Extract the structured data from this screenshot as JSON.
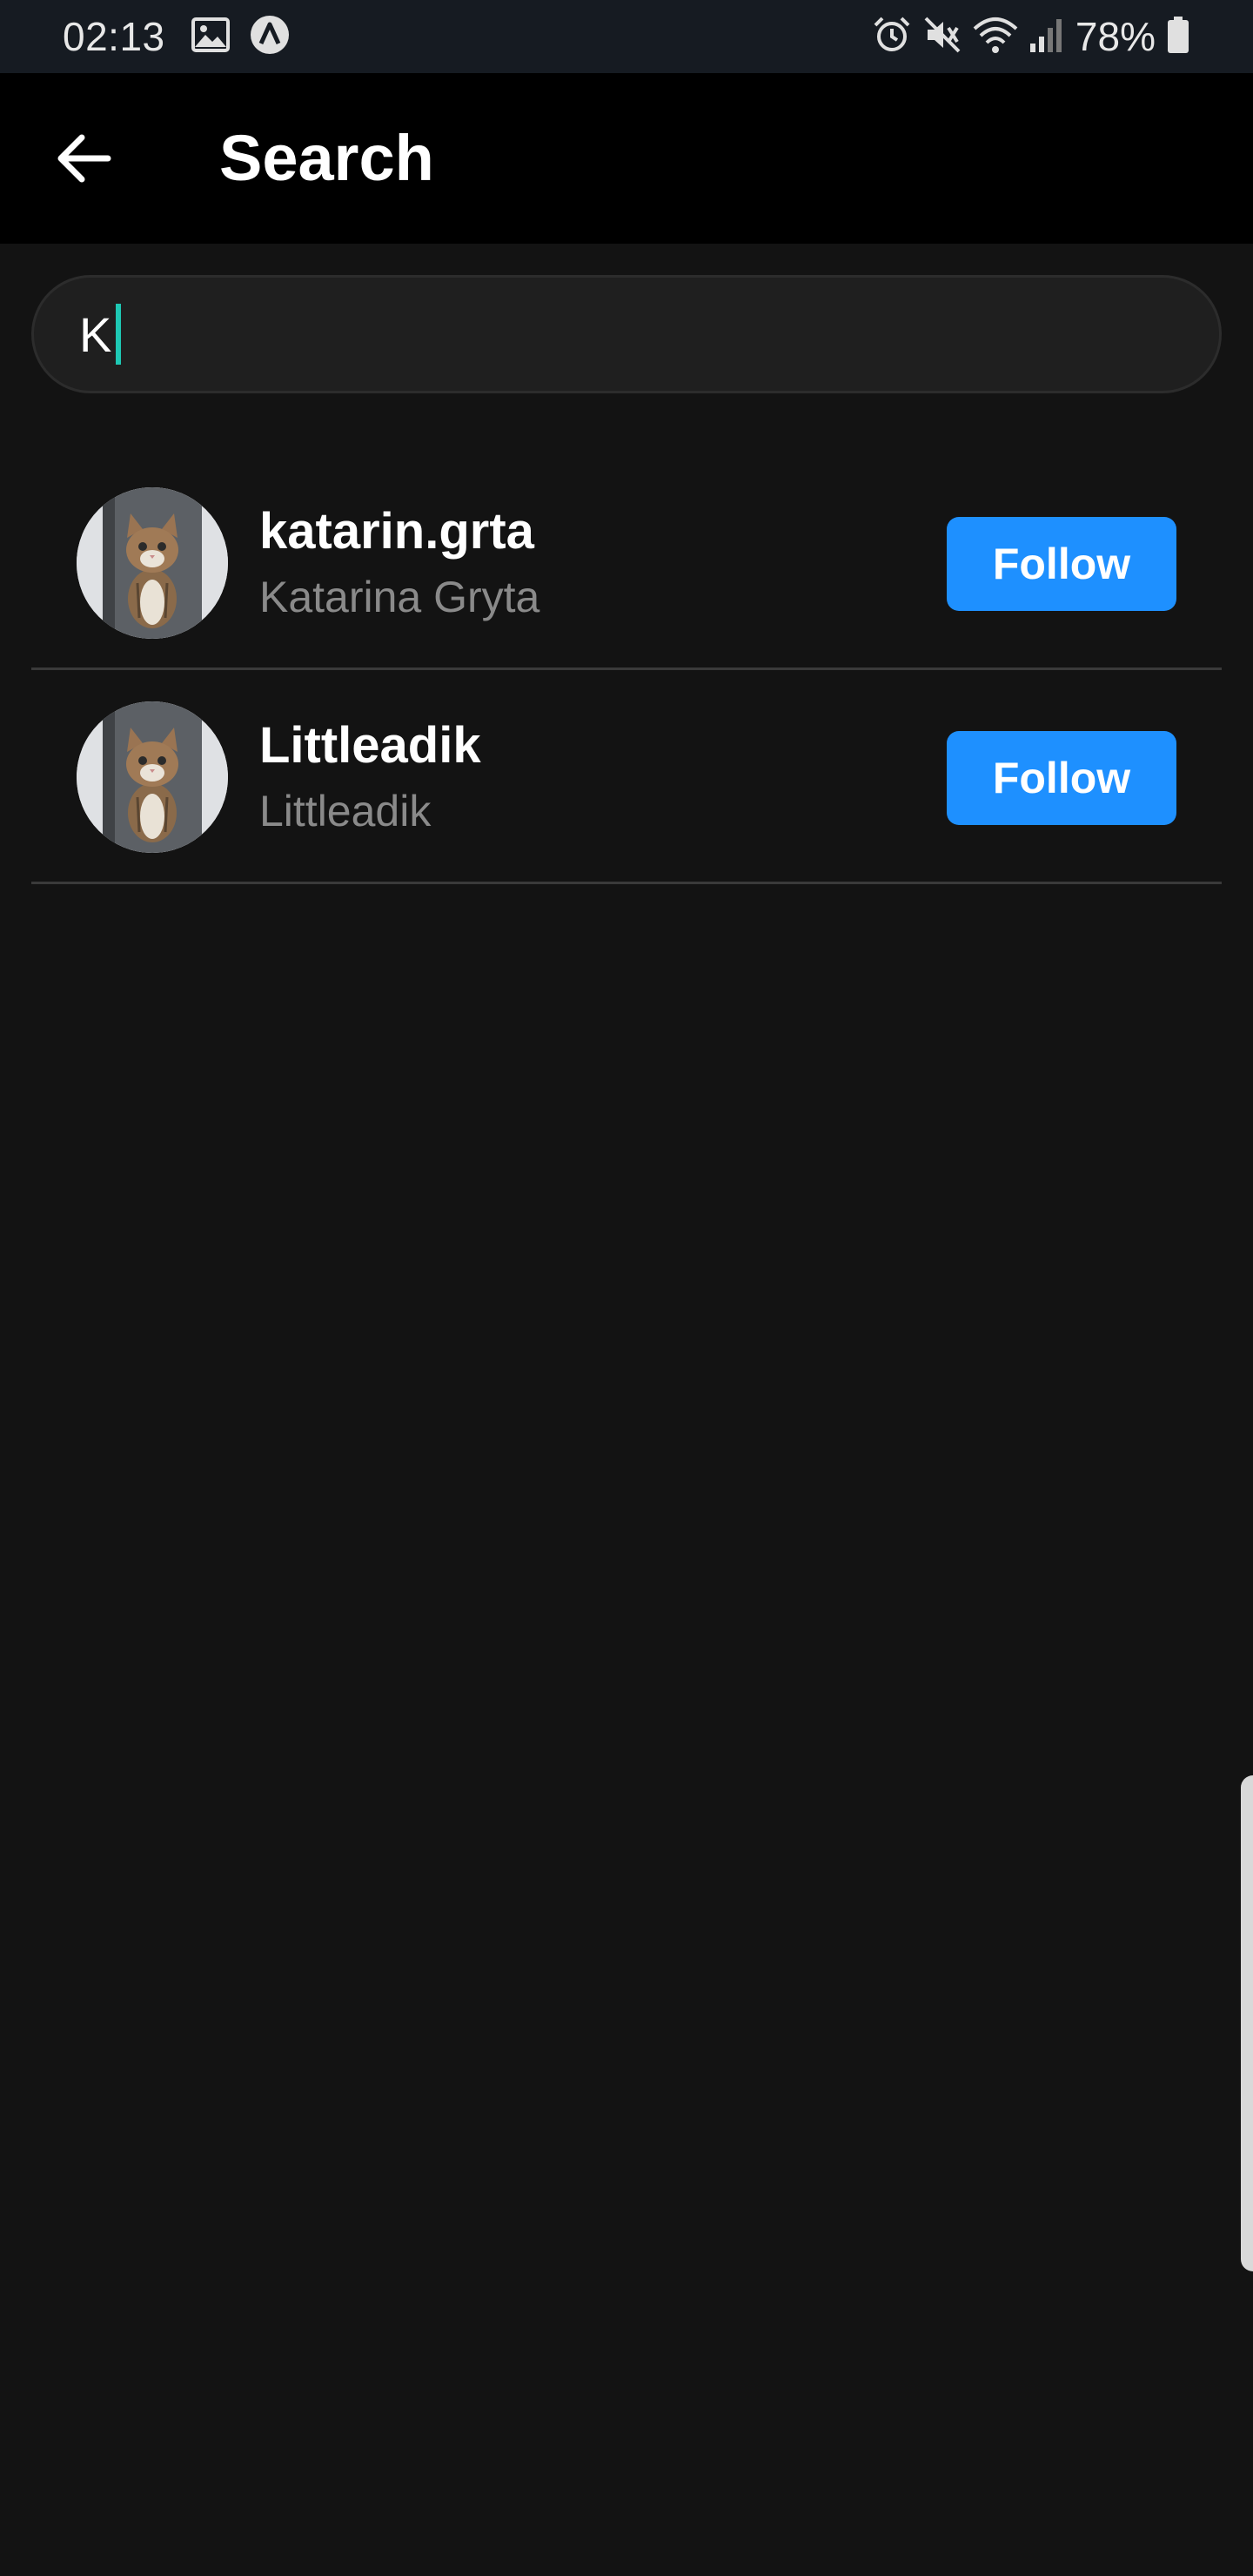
{
  "status_bar": {
    "time": "02:13",
    "battery": "78%",
    "icons": [
      "image-icon",
      "a-badge-icon",
      "alarm-icon",
      "vibrate-mute-icon",
      "wifi-icon",
      "signal-icon",
      "battery-icon"
    ]
  },
  "header": {
    "back_icon": "arrow-left-icon",
    "title": "Search"
  },
  "search": {
    "value": "K"
  },
  "results": [
    {
      "username": "katarin.grta",
      "full_name": "Katarina Gryta",
      "button_label": "Follow"
    },
    {
      "username": "Littleadik",
      "full_name": "Littleadik",
      "button_label": "Follow"
    }
  ],
  "colors": {
    "background": "#131313",
    "status_bar": "#161b22",
    "app_bar": "#000000",
    "accent_button": "#1e90ff",
    "caret": "#1ec8b4",
    "secondary_text": "#8a8a8a"
  }
}
